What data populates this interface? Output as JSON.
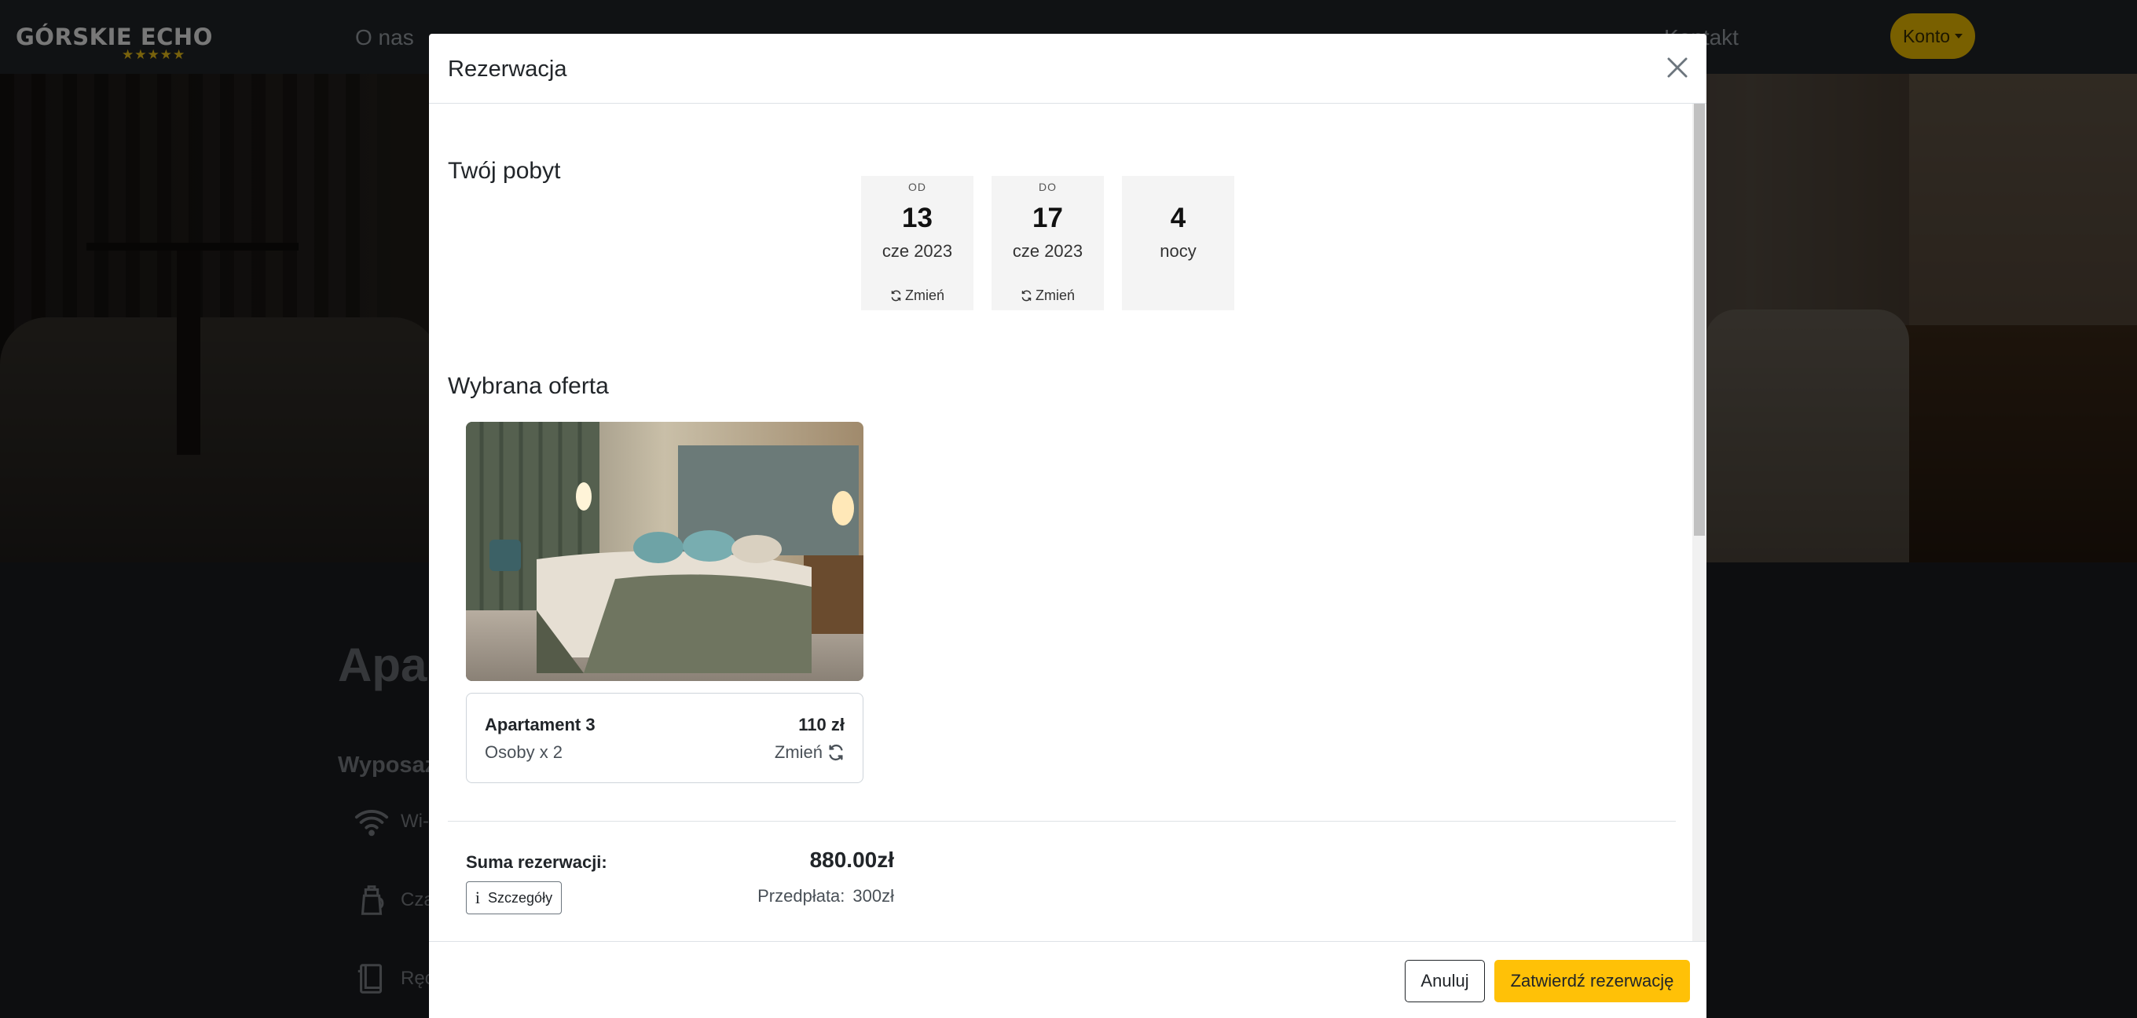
{
  "app": {
    "logo_text": "GÓRSKIE ECHO",
    "logo_stars": "★★★★★",
    "nav": [
      "O nas",
      "Kontakt"
    ],
    "account_label": "Konto"
  },
  "background": {
    "page_title": "Apar",
    "section_title": "Wyposaż",
    "amenities": [
      {
        "label": "Wi-",
        "icon": "wifi-icon"
      },
      {
        "label": "Czaj",
        "icon": "kettle-icon"
      },
      {
        "label": "Ręc",
        "icon": "towel-icon"
      }
    ]
  },
  "modal": {
    "title": "Rezerwacja",
    "stay": {
      "heading": "Twój pobyt",
      "from": {
        "label": "OD",
        "day": "13",
        "month": "cze 2023",
        "change": "Zmień"
      },
      "to": {
        "label": "DO",
        "day": "17",
        "month": "cze 2023",
        "change": "Zmień"
      },
      "nights": {
        "count": "4",
        "label": "nocy"
      }
    },
    "offer": {
      "heading": "Wybrana oferta",
      "name": "Apartament 3",
      "price": "110 zł",
      "persons": "Osoby x 2",
      "change": "Zmień"
    },
    "summary": {
      "label": "Suma rezerwacji:",
      "total": "880.00zł",
      "details_button": "Szczegóły",
      "prepayment_label": "Przedpłata:",
      "prepayment_value": "300zł"
    },
    "footer": {
      "cancel": "Anuluj",
      "confirm": "Zatwierdź rezerwację"
    }
  },
  "colors": {
    "accent": "#ffc107",
    "account_button": "#f3c100",
    "navbar": "#212529"
  }
}
